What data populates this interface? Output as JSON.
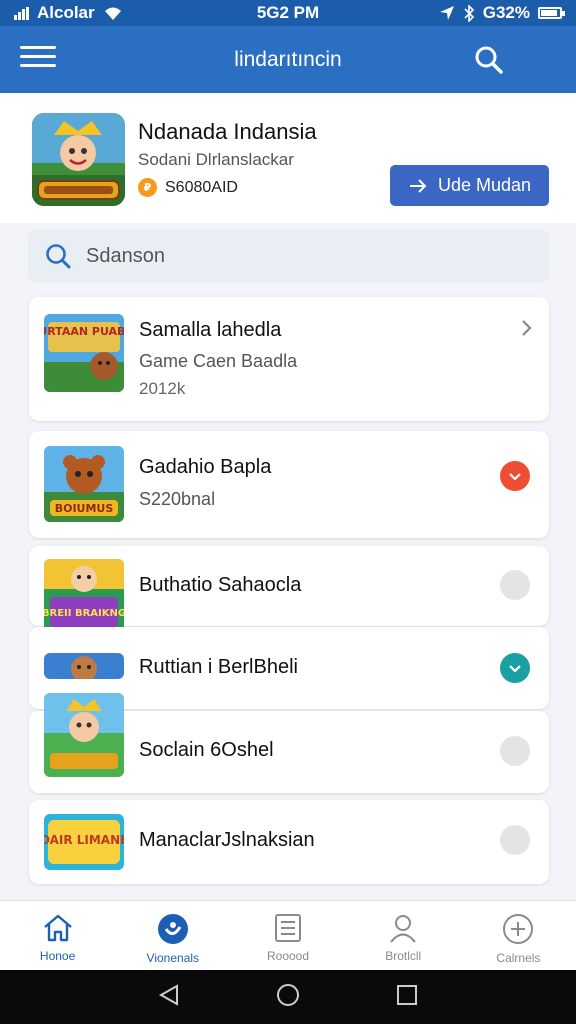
{
  "status_bar": {
    "carrier": "Alcolar",
    "time": "5G2 PM",
    "battery": "G32%",
    "battery_fraction": 0.9
  },
  "app_bar": {
    "title": "lindarıtıncin",
    "menu_icon": "hamburger-menu-icon",
    "search_icon": "search-icon"
  },
  "featured": {
    "title": "Ndanada Indansia",
    "subtitle": "Sodani Dlrlanslackar",
    "coin_label": "S6080AID",
    "coin_symbol": "₽",
    "button_label": "Ude Mudan",
    "button_icon": "arrow-right-icon"
  },
  "search": {
    "placeholder": "Sdanson"
  },
  "games": [
    {
      "title": "Samalla lahedla",
      "subtitle": "Game Caen Baadla",
      "meta": "2012k",
      "thumb_text": "KURTAAN PUABIK",
      "status": "chevron",
      "status_icon": "chevron-right-icon"
    },
    {
      "title": "Gadahio Bapla",
      "subtitle": "S220bnal",
      "meta": "",
      "thumb_text": "BOIUMUS",
      "status": "red",
      "status_icon": "check-icon"
    },
    {
      "title": "Buthatio Sahaocla",
      "subtitle": "",
      "meta": "",
      "thumb_text": "BREII BRAIKNG",
      "status": "grey",
      "status_icon": "radio-empty-icon"
    },
    {
      "title": "Ruttian i BerlBheli",
      "subtitle": "",
      "meta": "",
      "thumb_text": "",
      "status": "teal",
      "status_icon": "check-icon"
    },
    {
      "title": "Soclain 6Oshel",
      "subtitle": "",
      "meta": "",
      "thumb_text": "",
      "status": "grey",
      "status_icon": "radio-empty-icon"
    },
    {
      "title": "ManaclarJslnaksian",
      "subtitle": "",
      "meta": "",
      "thumb_text": "OAIR LIMANE",
      "status": "grey",
      "status_icon": "radio-empty-icon"
    }
  ],
  "bottom_nav": [
    {
      "label": "Honoe",
      "icon": "home-icon",
      "active": false
    },
    {
      "label": "Vionenals",
      "icon": "compass-icon",
      "active": true
    },
    {
      "label": "Rooood",
      "icon": "list-icon",
      "active": false
    },
    {
      "label": "Brotlcll",
      "icon": "profile-icon",
      "active": false
    },
    {
      "label": "Calrnels",
      "icon": "plus-circle-icon",
      "active": false
    }
  ],
  "system_nav": [
    "back-icon",
    "home-circle-icon",
    "recents-icon"
  ],
  "colors": {
    "status_bar": "#1c5dab",
    "app_bar": "#2a6fc2",
    "primary_button": "#3c66c4",
    "active_nav": "#1d5fb4",
    "red_badge": "#ef4d33",
    "teal_badge": "#1aa0a2"
  }
}
